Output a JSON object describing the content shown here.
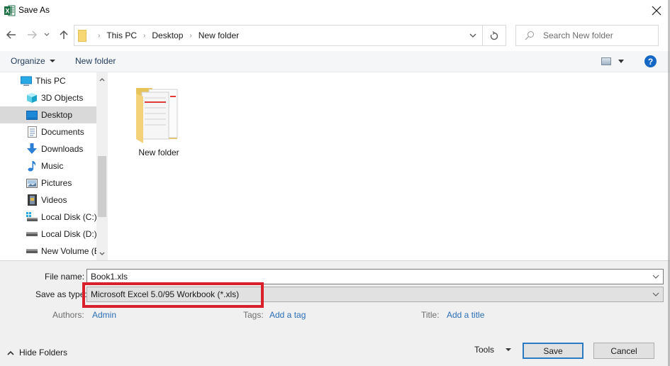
{
  "window": {
    "title": "Save As",
    "app_icon": "excel-icon"
  },
  "nav": {
    "back_icon": "arrow-left-icon",
    "forward_icon": "arrow-right-icon",
    "recent_icon": "chevron-down-icon",
    "up_icon": "arrow-up-icon",
    "breadcrumbs": [
      "This PC",
      "Desktop",
      "New folder"
    ],
    "refresh_icon": "refresh-icon",
    "search_placeholder": "Search New folder"
  },
  "toolbar": {
    "organize_label": "Organize",
    "new_folder_label": "New folder",
    "help_label": "?"
  },
  "sidebar": {
    "items": [
      {
        "label": "This PC",
        "icon": "computer-icon",
        "selected": false
      },
      {
        "label": "3D Objects",
        "icon": "cube-3d-icon",
        "selected": false
      },
      {
        "label": "Desktop",
        "icon": "desktop-icon",
        "selected": true
      },
      {
        "label": "Documents",
        "icon": "document-icon",
        "selected": false
      },
      {
        "label": "Downloads",
        "icon": "download-arrow-icon",
        "selected": false
      },
      {
        "label": "Music",
        "icon": "music-note-icon",
        "selected": false
      },
      {
        "label": "Pictures",
        "icon": "picture-icon",
        "selected": false
      },
      {
        "label": "Videos",
        "icon": "film-icon",
        "selected": false
      },
      {
        "label": "Local Disk (C:)",
        "icon": "system-drive-icon",
        "selected": false
      },
      {
        "label": "Local Disk (D:)",
        "icon": "drive-icon",
        "selected": false
      },
      {
        "label": "New Volume (E",
        "icon": "drive-icon",
        "selected": false
      }
    ]
  },
  "content": {
    "items": [
      {
        "label": "New folder",
        "type": "folder"
      }
    ]
  },
  "form": {
    "file_name_label": "File name:",
    "file_name_value": "Book1.xls",
    "save_as_type_label": "Save as type:",
    "save_as_type_value": "Microsoft Excel 5.0/95 Workbook (*.xls)",
    "authors_label": "Authors:",
    "authors_value": "Admin",
    "tags_label": "Tags:",
    "tags_value": "Add a tag",
    "title_label": "Title:",
    "title_value": "Add a title"
  },
  "footer": {
    "hide_folders_label": "Hide Folders",
    "tools_label": "Tools",
    "save_label": "Save",
    "cancel_label": "Cancel"
  },
  "colors": {
    "highlight": "#d9202a",
    "link": "#2a6fb6",
    "primary_border": "#2b7bc4",
    "help": "#1467c4"
  }
}
